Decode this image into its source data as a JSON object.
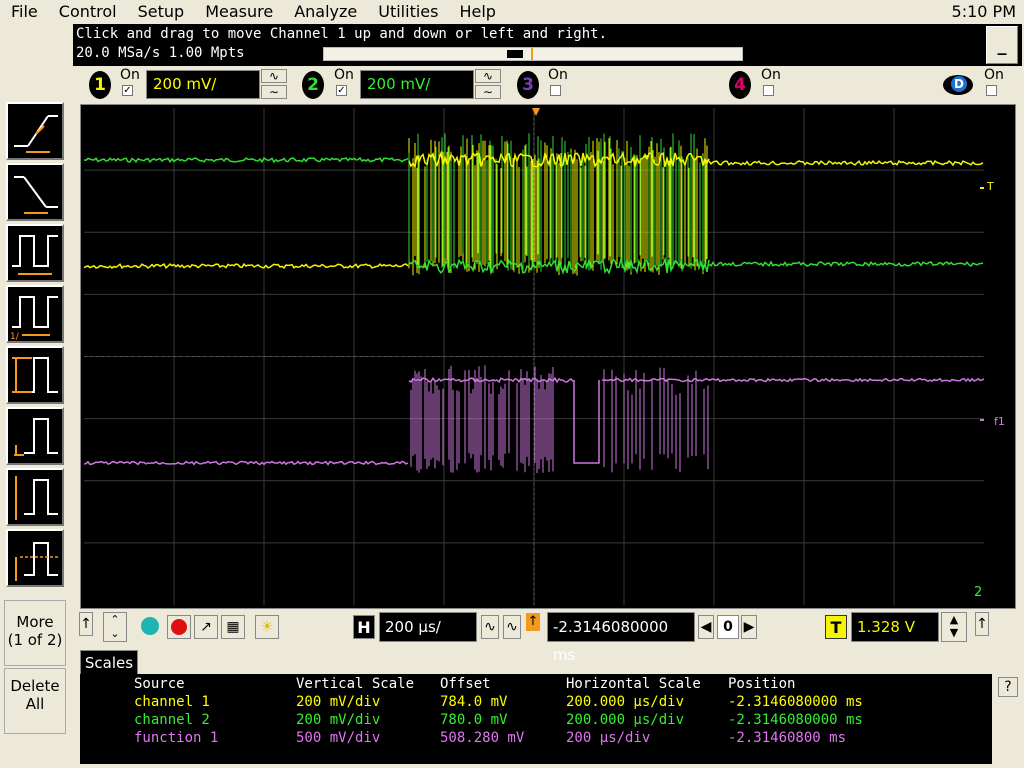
{
  "menu": [
    "File",
    "Control",
    "Setup",
    "Measure",
    "Analyze",
    "Utilities",
    "Help"
  ],
  "clock": "5:10 PM",
  "status": {
    "message": "Click and drag to move Channel 1 up and down or left and right.",
    "rate": "20.0 MSa/s   1.00 Mpts"
  },
  "minimize_label": "_",
  "channels": [
    {
      "num": "1",
      "on_label": "On",
      "checked": "✓",
      "scale": "200 mV/",
      "color": "#f5f500",
      "text_color": "#ffff00"
    },
    {
      "num": "2",
      "on_label": "On",
      "checked": "✓",
      "scale": "200 mV/",
      "color": "#33dd33",
      "text_color": "#33ee33"
    },
    {
      "num": "3",
      "on_label": "On",
      "checked": "",
      "color": "#7b3fb5"
    },
    {
      "num": "4",
      "on_label": "On",
      "checked": "",
      "color": "#e0006a"
    }
  ],
  "digital": {
    "label": "D",
    "on_label": "On"
  },
  "side_buttons": {
    "more": "More\n(1 of 2)",
    "more_line1": "More",
    "more_line2": "(1 of 2)",
    "delete_line1": "Delete",
    "delete_line2": "All"
  },
  "scope": {
    "marker_t": "T",
    "marker_f1": "f1",
    "marker_2": "2"
  },
  "controls": {
    "h_label": "H",
    "timebase": "200 µs/",
    "position": "-2.3146080000 ms",
    "zero": "0",
    "t_label": "T",
    "trigger_level": "1.328 V"
  },
  "tab": "Scales",
  "table": {
    "headers": [
      "Source",
      "Vertical Scale",
      "Offset",
      "Horizontal Scale",
      "Position"
    ],
    "rows": [
      {
        "source": "channel 1",
        "vscale": "200 mV/div",
        "offset": "784.0 mV",
        "hscale": "200.000 µs/div",
        "position": "-2.3146080000 ms",
        "color": "#ffff00"
      },
      {
        "source": "channel 2",
        "vscale": "200 mV/div",
        "offset": "780.0 mV",
        "hscale": "200.000 µs/div",
        "position": "-2.3146080000 ms",
        "color": "#33ee33"
      },
      {
        "source": "function 1",
        "vscale": "500 mV/div",
        "offset": "508.280 mV",
        "hscale": "200 µs/div",
        "position": "-2.31460800 ms",
        "color": "#dd77ee"
      }
    ]
  },
  "help_label": "?"
}
